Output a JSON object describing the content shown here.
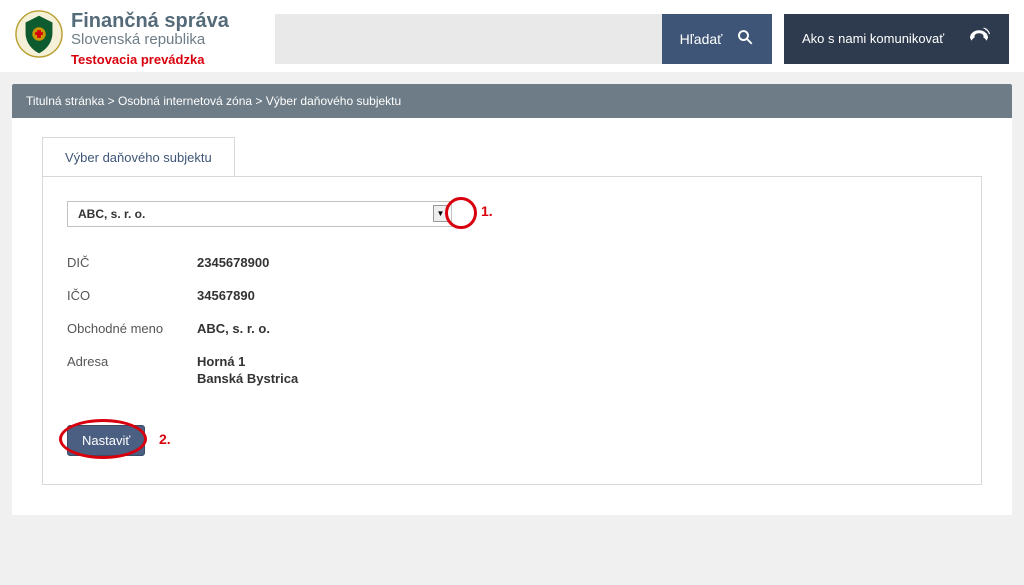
{
  "header": {
    "title": "Finančná správa",
    "subtitle": "Slovenská republika",
    "test_label": "Testovacia prevádzka",
    "search_placeholder": "",
    "search_button": "Hľadať",
    "communicate_button": "Ako s nami komunikovať"
  },
  "breadcrumb": {
    "home": "Titulná stránka",
    "zone": "Osobná internetová zóna",
    "current": "Výber daňového subjektu",
    "sep": " > "
  },
  "tab": {
    "label": "Výber daňového subjektu"
  },
  "subject_select": {
    "value": "ABC, s. r. o."
  },
  "details": {
    "dic_label": "DIČ",
    "dic_value": "2345678900",
    "ico_label": "IČO",
    "ico_value": "34567890",
    "name_label": "Obchodné meno",
    "name_value": "ABC, s. r. o.",
    "address_label": "Adresa",
    "address_line1": "Horná 1",
    "address_line2": "Banská Bystrica"
  },
  "actions": {
    "set_button": "Nastaviť"
  },
  "annotations": {
    "one": "1.",
    "two": "2."
  }
}
